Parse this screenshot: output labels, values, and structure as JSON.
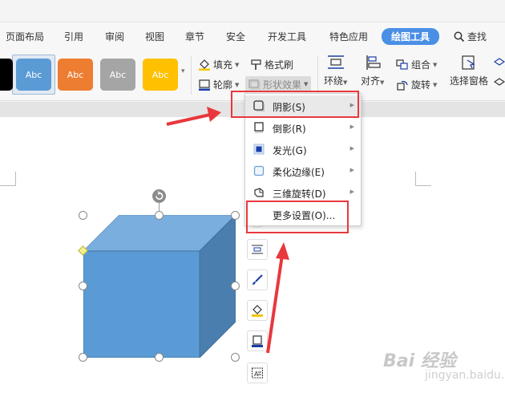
{
  "tabs": [
    {
      "label": "页面布局"
    },
    {
      "label": "引用"
    },
    {
      "label": "审阅"
    },
    {
      "label": "视图"
    },
    {
      "label": "章节"
    },
    {
      "label": "安全"
    },
    {
      "label": "开发工具"
    },
    {
      "label": "特色应用"
    },
    {
      "label": "绘图工具",
      "active": true
    }
  ],
  "search": {
    "label": "查找",
    "icon": "search-icon"
  },
  "styles": [
    {
      "label": "",
      "color": "#000000"
    },
    {
      "label": "Abc",
      "color": "#5b9bd5",
      "selected": true
    },
    {
      "label": "Abc",
      "color": "#ed7d31"
    },
    {
      "label": "Abc",
      "color": "#a5a5a5"
    },
    {
      "label": "Abc",
      "color": "#ffc000"
    }
  ],
  "ribbon": {
    "fill": "填充",
    "format_brush": "格式刷",
    "outline": "轮廓",
    "shape_effects": "形状效果",
    "wrap": "环绕",
    "align": "对齐",
    "group": "组合",
    "rotate": "旋转",
    "selection_pane": "选择窗格"
  },
  "menu": {
    "items": [
      {
        "label": "阴影(S)",
        "icon": "shadow-icon",
        "submenu": true,
        "highlighted": true
      },
      {
        "label": "倒影(R)",
        "icon": "reflection-icon",
        "submenu": true
      },
      {
        "label": "发光(G)",
        "icon": "glow-icon",
        "submenu": true
      },
      {
        "label": "柔化边缘(E)",
        "icon": "soft-edge-icon",
        "submenu": true
      },
      {
        "label": "三维旋转(D)",
        "icon": "3d-rotation-icon",
        "submenu": true
      },
      {
        "label": "更多设置(O)...",
        "icon": "",
        "submenu": false
      }
    ]
  },
  "colors": {
    "accent": "#4a8fe6",
    "cube_front": "#5b9bd5",
    "cube_top": "#7aaedf",
    "cube_side": "#4a7eaf",
    "annotation_red": "#e8383d"
  },
  "watermark": {
    "brand": "Bai 经验",
    "sub": "jingyan.baidu.com"
  }
}
